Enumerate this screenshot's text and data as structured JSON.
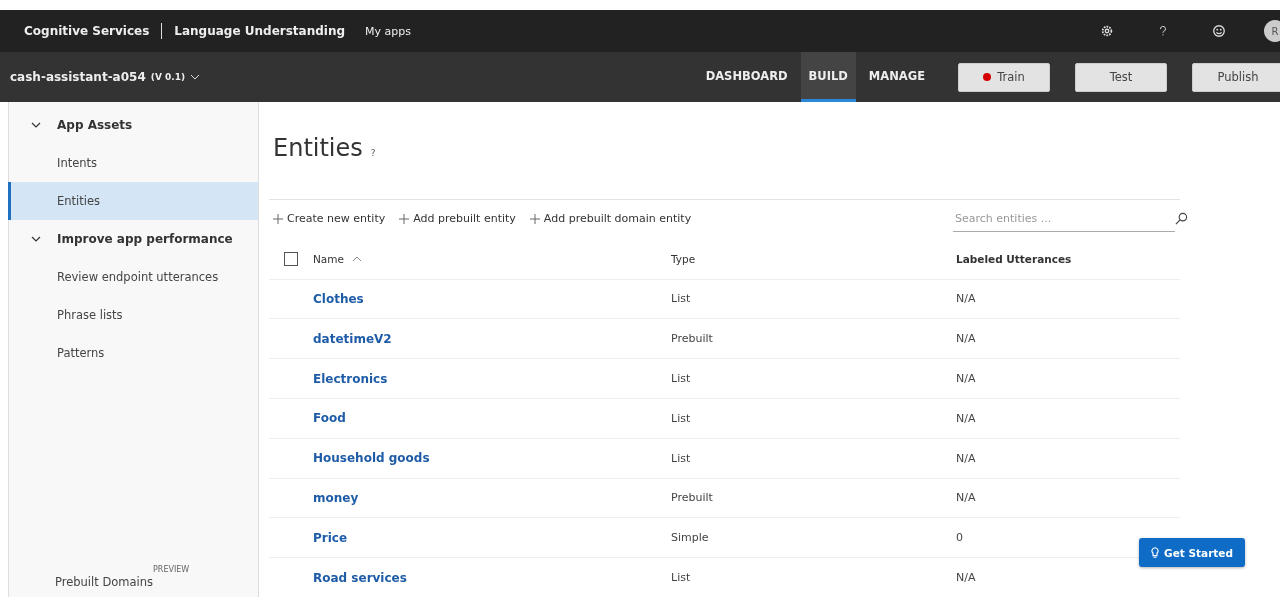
{
  "top_bar": {
    "brand": "Cognitive Services",
    "product": "Language Understanding",
    "link": "My apps",
    "avatar": "R"
  },
  "app_bar": {
    "app_name": "cash-assistant-a054",
    "version": "(V 0.1)",
    "tabs": [
      {
        "label": "DASHBOARD",
        "selected": false
      },
      {
        "label": "BUILD",
        "selected": true
      },
      {
        "label": "MANAGE",
        "selected": false
      }
    ],
    "buttons": [
      {
        "label": "Train",
        "kind": "train"
      },
      {
        "label": "Test",
        "kind": "plain"
      },
      {
        "label": "Publish",
        "kind": "plain"
      }
    ]
  },
  "sidebar": {
    "sections": [
      {
        "label": "App Assets",
        "expanded": true,
        "items": [
          {
            "label": "Intents",
            "selected": false
          },
          {
            "label": "Entities",
            "selected": true
          }
        ]
      },
      {
        "label": "Improve app performance",
        "expanded": true,
        "items": [
          {
            "label": "Review endpoint utterances",
            "selected": false
          },
          {
            "label": "Phrase lists",
            "selected": false
          },
          {
            "label": "Patterns",
            "selected": false
          }
        ]
      }
    ],
    "footer": {
      "label": "Prebuilt Domains",
      "badge": "PREVIEW"
    }
  },
  "page": {
    "title": "Entities",
    "help": "?",
    "actions": [
      "Create new entity",
      "Add prebuilt entity",
      "Add prebuilt domain entity"
    ],
    "search": {
      "placeholder": "Search entities ..."
    },
    "table": {
      "select_all_checked": false,
      "columns": [
        "Name",
        "Type",
        "Labeled Utterances"
      ],
      "rows": [
        {
          "name": "Clothes",
          "type": "List",
          "labeled": "N/A"
        },
        {
          "name": "datetimeV2",
          "type": "Prebuilt",
          "labeled": "N/A"
        },
        {
          "name": "Electronics",
          "type": "List",
          "labeled": "N/A"
        },
        {
          "name": "Food",
          "type": "List",
          "labeled": "N/A"
        },
        {
          "name": "Household goods",
          "type": "List",
          "labeled": "N/A"
        },
        {
          "name": "money",
          "type": "Prebuilt",
          "labeled": "N/A"
        },
        {
          "name": "Price",
          "type": "Simple",
          "labeled": "0"
        },
        {
          "name": "Road services",
          "type": "List",
          "labeled": "N/A"
        }
      ]
    }
  },
  "get_started": "Get Started"
}
